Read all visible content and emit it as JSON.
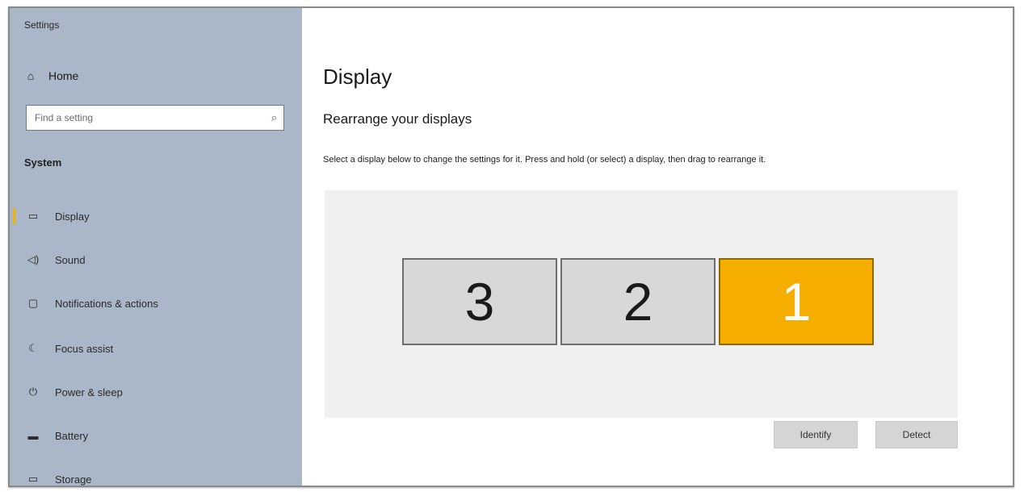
{
  "window": {
    "title": "Settings"
  },
  "sidebar": {
    "home_label": "Home",
    "search_placeholder": "Find a setting",
    "section_label": "System",
    "items": [
      {
        "label": "Display",
        "icon": "display-icon"
      },
      {
        "label": "Sound",
        "icon": "speaker-icon"
      },
      {
        "label": "Notifications & actions",
        "icon": "notification-icon"
      },
      {
        "label": "Focus assist",
        "icon": "moon-icon"
      },
      {
        "label": "Power & sleep",
        "icon": "power-icon"
      },
      {
        "label": "Battery",
        "icon": "battery-icon"
      },
      {
        "label": "Storage",
        "icon": "storage-icon"
      }
    ],
    "active_item": "Display"
  },
  "main": {
    "title": "Display",
    "subtitle": "Rearrange your displays",
    "description": "Select a display below to change the settings for it. Press and hold (or select) a display, then drag to rearrange it.",
    "monitors": [
      {
        "number": "3",
        "selected": false
      },
      {
        "number": "2",
        "selected": false
      },
      {
        "number": "1",
        "selected": true
      }
    ],
    "identify_label": "Identify",
    "detect_label": "Detect"
  },
  "colors": {
    "sidebar_bg": "#a9b7c8",
    "accent": "#f5ad00",
    "monitor_bg": "#d8d8d8",
    "canvas_bg": "#f0f0f0"
  }
}
